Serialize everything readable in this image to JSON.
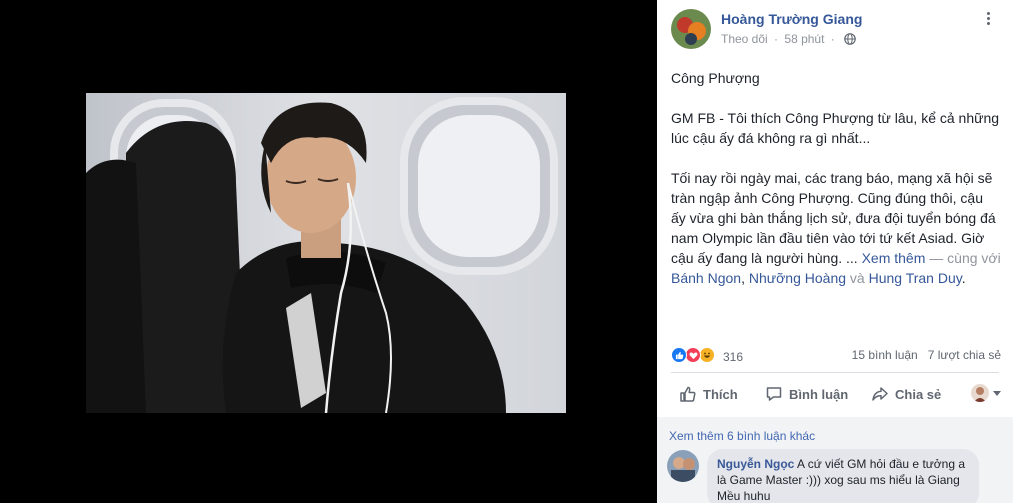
{
  "photo": {
    "alt_icon": "photo-of-sleeping-man"
  },
  "post": {
    "author": "Hoàng Trường Giang",
    "follow": "Theo dõi",
    "separator": "·",
    "time": "58 phút",
    "privacy_icon": "globe-icon",
    "paragraphs": {
      "p1": "Công Phượng",
      "p2": "GM FB - Tôi thích Công Phượng từ lâu, kể cả những lúc cậu ấy đá không ra gì nhất...",
      "p3": "Tối nay rồi ngày mai, các trang báo, mạng xã hội sẽ tràn ngập ảnh Công Phượng. Cũng đúng thôi, cậu ấy vừa ghi bàn thắng lịch sử, đưa đội tuyển bóng đá nam Olympic lần đầu tiên vào tới tứ kết Asiad. Giờ cậu ấy đang là người hùng. ..."
    },
    "see_more": "Xem thêm",
    "with_text": "— cùng với",
    "tag1": "Bánh Ngon",
    "comma": ",",
    "tag2": "Nhưỡng Hoàng",
    "and": "và",
    "tag3": "Hung Tran Duy",
    "period": "."
  },
  "stats": {
    "reaction_count": "316",
    "comments": "15 bình luận",
    "shares": "7 lượt chia sẻ",
    "reaction_icons": [
      "like-icon",
      "love-icon",
      "haha-icon"
    ],
    "colors": {
      "like": "#1877f2",
      "love": "#f33e58",
      "haha": "#f7b125"
    }
  },
  "actions": {
    "like": "Thích",
    "comment": "Bình luận",
    "share": "Chia sẻ"
  },
  "comments": {
    "view_more": "Xem thêm 6 bình luận khác",
    "items": [
      {
        "name": "Nguyễn Ngọc",
        "text": "A cứ viết GM hỏi đầu e tưởng a là Game Master :))) xog sau ms hiểu là Giang Mều huhu"
      }
    ]
  },
  "colors": {
    "link": "#365899",
    "muted": "#90949c",
    "panel_bg": "#ffffff",
    "viewer_bg": "#000000"
  }
}
